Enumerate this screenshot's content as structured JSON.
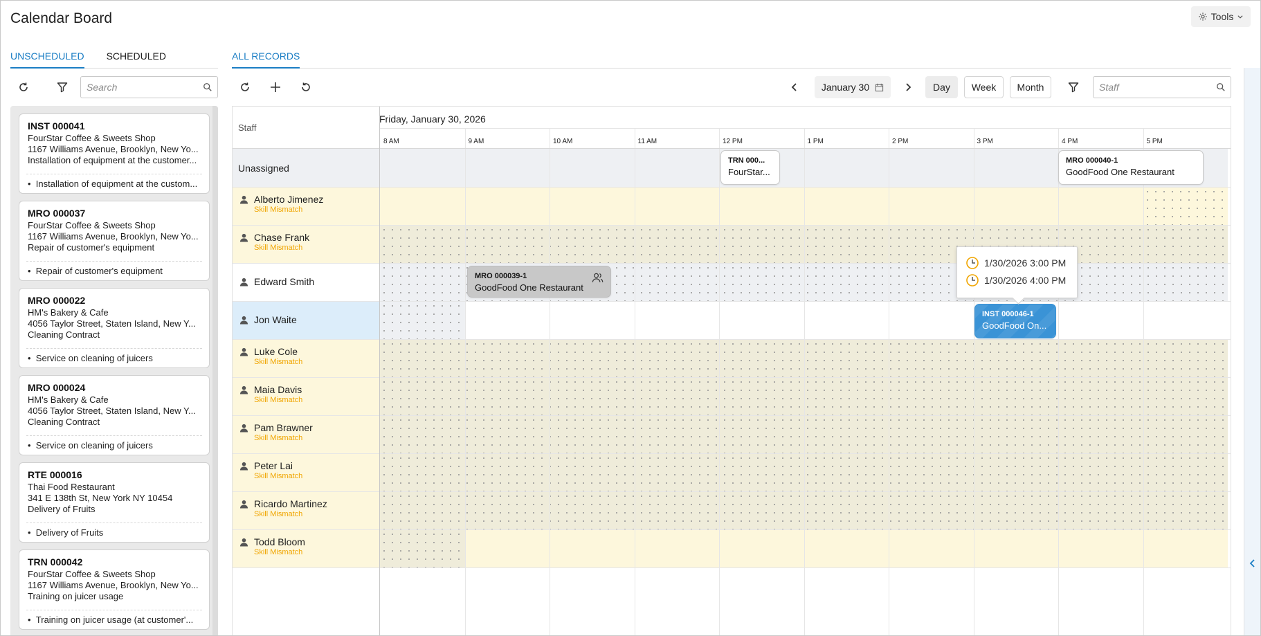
{
  "page": {
    "title": "Calendar Board",
    "tools_label": "Tools"
  },
  "left_tabs": [
    "UNSCHEDULED",
    "SCHEDULED"
  ],
  "right_tabs": [
    "ALL RECORDS"
  ],
  "left_search": {
    "placeholder": "Search"
  },
  "staff_search": {
    "placeholder": "Staff"
  },
  "cards": [
    {
      "id": "INST 000041",
      "customer": "FourStar Coffee & Sweets Shop",
      "address": "1167 Williams Avenue, Brooklyn, New Yo...",
      "desc": "Installation of equipment at the customer...",
      "bullet": "Installation of equipment at the custom..."
    },
    {
      "id": "MRO 000037",
      "customer": "FourStar Coffee & Sweets Shop",
      "address": "1167 Williams Avenue, Brooklyn, New Yo...",
      "desc": "Repair of customer's equipment",
      "bullet": "Repair of customer's equipment"
    },
    {
      "id": "MRO 000022",
      "customer": "HM's Bakery & Cafe",
      "address": "4056 Taylor Street, Staten Island, New Y...",
      "desc": "Cleaning Contract",
      "bullet": "Service on cleaning of juicers"
    },
    {
      "id": "MRO 000024",
      "customer": "HM's Bakery & Cafe",
      "address": "4056 Taylor Street, Staten Island, New Y...",
      "desc": "Cleaning Contract",
      "bullet": "Service on cleaning of juicers"
    },
    {
      "id": "RTE 000016",
      "customer": "Thai Food Restaurant",
      "address": "341 E 138th St, New York NY 10454",
      "desc": "Delivery of Fruits",
      "bullet": "Delivery of Fruits"
    },
    {
      "id": "TRN 000042",
      "customer": "FourStar Coffee & Sweets Shop",
      "address": "1167 Williams Avenue, Brooklyn, New Yo...",
      "desc": "Training on juicer usage",
      "bullet": "Training on juicer usage (at customer'..."
    }
  ],
  "date_nav": {
    "date_label": "January 30",
    "views": [
      "Day",
      "Week",
      "Month"
    ],
    "active_view": "Day"
  },
  "calendar": {
    "staff_header": "Staff",
    "date_header": "Friday, January 30, 2026",
    "hours": [
      "8 AM",
      "9 AM",
      "10 AM",
      "11 AM",
      "12 PM",
      "1 PM",
      "2 PM",
      "3 PM",
      "4 PM",
      "5 PM"
    ],
    "rows": [
      {
        "name": "Unassigned",
        "sub": ""
      },
      {
        "name": "Alberto Jimenez",
        "sub": "Skill Mismatch"
      },
      {
        "name": "Chase Frank",
        "sub": "Skill Mismatch"
      },
      {
        "name": "Edward Smith",
        "sub": ""
      },
      {
        "name": "Jon Waite",
        "sub": ""
      },
      {
        "name": "Luke Cole",
        "sub": "Skill Mismatch"
      },
      {
        "name": "Maia Davis",
        "sub": "Skill Mismatch"
      },
      {
        "name": "Pam Brawner",
        "sub": "Skill Mismatch"
      },
      {
        "name": "Peter Lai",
        "sub": "Skill Mismatch"
      },
      {
        "name": "Ricardo Martinez",
        "sub": "Skill Mismatch"
      },
      {
        "name": "Todd Bloom",
        "sub": "Skill Mismatch"
      }
    ],
    "events": [
      {
        "id": "TRN 000...",
        "name": "FourStar..."
      },
      {
        "id": "MRO 000040-1",
        "name": "GoodFood One Restaurant"
      },
      {
        "id": "MRO 000039-1",
        "name": "GoodFood One Restaurant"
      },
      {
        "id": "INST 000046-1",
        "name": "GoodFood On..."
      }
    ],
    "tooltip": {
      "start": "1/30/2026 3:00 PM",
      "end": "1/30/2026 4:00 PM"
    }
  },
  "colors": {
    "accent": "#1a7dc4",
    "skill_mismatch": "#f0a500",
    "event_blue": "#3a93d6",
    "clock": "#f0a500"
  }
}
